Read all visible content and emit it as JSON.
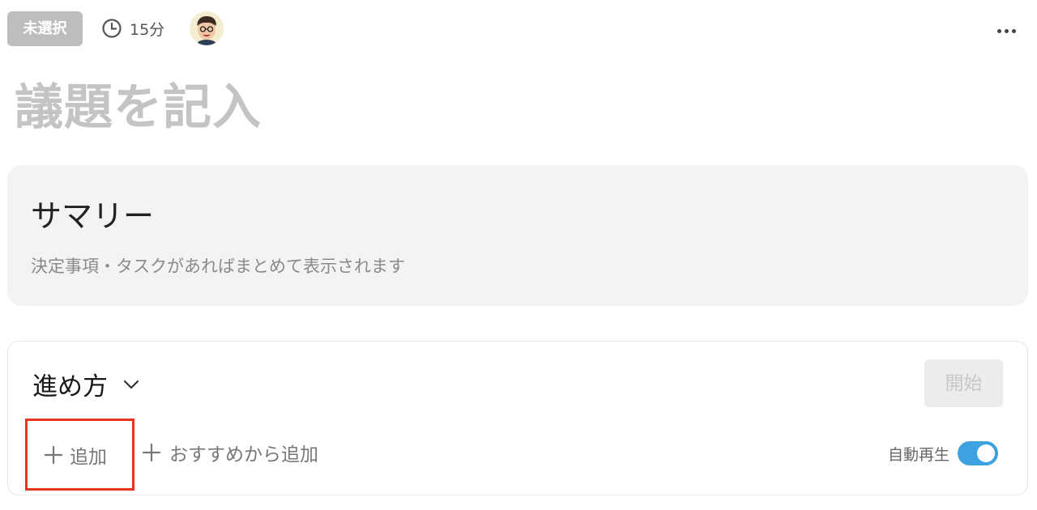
{
  "header": {
    "status_badge": "未選択",
    "duration": "15分",
    "clock_icon": "clock-icon",
    "avatar_icon": "user-avatar",
    "more_icon": "more-horizontal-icon"
  },
  "agenda": {
    "title_placeholder": "議題を記入"
  },
  "summary": {
    "title": "サマリー",
    "description": "決定事項・タスクがあればまとめて表示されます"
  },
  "steps": {
    "title": "進め方",
    "start_label": "開始",
    "add_label": "追加",
    "add_recommended_label": "おすすめから追加",
    "autoplay_label": "自動再生",
    "autoplay_on": true
  },
  "colors": {
    "accent_toggle": "#3ea1e0",
    "highlight_border": "#e8341c"
  }
}
